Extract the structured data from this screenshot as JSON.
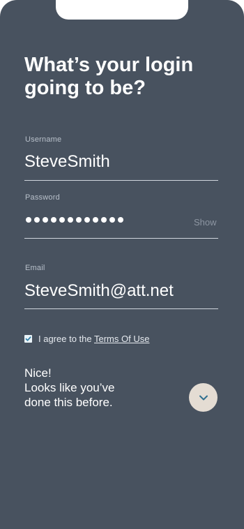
{
  "header": {
    "title": "What’s your login going to be?"
  },
  "form": {
    "username": {
      "label": "Username",
      "value": "SteveSmith"
    },
    "password": {
      "label": "Password",
      "masked_length": 12,
      "show_label": "Show"
    },
    "email": {
      "label": "Email",
      "value": "SteveSmith@att.net"
    },
    "terms": {
      "checked": true,
      "prefix": "I agree to the ",
      "link_label": "Terms Of Use"
    }
  },
  "message": {
    "line1": "Nice!",
    "line2": "Looks like you’ve",
    "line3": "done this before."
  },
  "next_button": {
    "icon": "chevron-down-icon"
  },
  "colors": {
    "background": "#48525f",
    "accent_button": "#e4dcd3",
    "chevron": "#2f6f8f",
    "checkbox_check": "#2f7fa8"
  }
}
